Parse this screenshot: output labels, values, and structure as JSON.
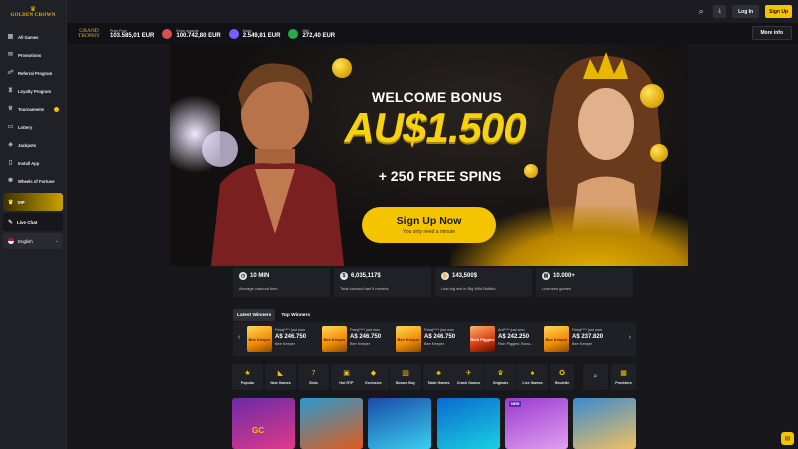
{
  "brand": {
    "name": "GOLDEN CROWN"
  },
  "sidebar": {
    "items": [
      {
        "label": "All Games",
        "icon": "grid-icon"
      },
      {
        "label": "Promotions",
        "icon": "gift-icon"
      },
      {
        "label": "Referral Program",
        "icon": "referral-icon"
      },
      {
        "label": "Loyalty Program",
        "icon": "loyalty-icon"
      },
      {
        "label": "Tournaments",
        "icon": "trophy-icon"
      },
      {
        "label": "Lottery",
        "icon": "ticket-icon"
      },
      {
        "label": "Jackpots",
        "icon": "jackpot-icon"
      },
      {
        "label": "Install App",
        "icon": "phone-icon"
      },
      {
        "label": "Wheels of Fortune",
        "icon": "wheel-icon"
      }
    ],
    "vip": "VIP",
    "live_chat": "Live Chat",
    "language": "English"
  },
  "header": {
    "login": "Log In",
    "signup": "Sign Up"
  },
  "jackpots": {
    "logo_line1": "GRAND",
    "logo_line2": "TROPHY",
    "items": [
      {
        "label": "Prize Pool",
        "value": "103.585,01 EUR"
      },
      {
        "label": "Extra rewards",
        "value": "100.742,80 EUR"
      },
      {
        "label": "Major",
        "value": "2.549,81 EUR"
      },
      {
        "label": "Mini",
        "value": "272,40 EUR"
      }
    ],
    "more_info": "More info",
    "colors": [
      "#e23a3a",
      "#d94f4f",
      "#7a5cff",
      "#2aa84a"
    ]
  },
  "hero": {
    "welcome": "WELCOME BONUS",
    "amount": "AU$1.500",
    "spins": "+ 250 FREE SPINS",
    "cta": "Sign Up Now",
    "cta_sub": "You only need a minute"
  },
  "stats": [
    {
      "value": "10 MIN",
      "label": "Average cashout time."
    },
    {
      "value": "6,035,117$",
      "label": "Total cashout last 5 months"
    },
    {
      "value": "143,500$",
      "label": "Last big win in Big Wild Buffalo"
    },
    {
      "value": "10.000+",
      "label": "Licensed games"
    }
  ],
  "winners": {
    "tabs": [
      "Latest Winners",
      "Top Winners"
    ],
    "items": [
      {
        "who": "Fessj**** just won",
        "amount": "A$ 246.750",
        "game": "Bee Keeper",
        "thumb": "Bee Keeper"
      },
      {
        "who": "Fessj**** just won",
        "amount": "A$ 246.750",
        "game": "Bee Keeper",
        "thumb": "Bee Keeper"
      },
      {
        "who": "Fessj**** just won",
        "amount": "A$ 246.750",
        "game": "Bee Keeper",
        "thumb": "Bee Keeper"
      },
      {
        "who": "Ant**** just won",
        "amount": "A$ 242.250",
        "game": "Rich Piggies: Bonu...",
        "thumb": "Rich Piggies"
      },
      {
        "who": "Fessj**** just won",
        "amount": "A$ 237.820",
        "game": "Bee Keeper",
        "thumb": "Bee Keeper"
      }
    ]
  },
  "categories": [
    {
      "label": "Popular",
      "icon": "star-icon"
    },
    {
      "label": "New Games",
      "icon": "new-icon"
    },
    {
      "label": "Slots",
      "icon": "slot-icon"
    },
    {
      "label": "Hot RTP",
      "icon": "rtp-icon"
    },
    {
      "label": "Exclusive",
      "icon": "diamond-icon"
    },
    {
      "label": "Bonus Buy",
      "icon": "bonus-icon"
    },
    {
      "label": "Table Games",
      "icon": "cards-icon"
    },
    {
      "label": "Crash Games",
      "icon": "crash-icon"
    },
    {
      "label": "Originals",
      "icon": "crown-icon"
    },
    {
      "label": "Live Games",
      "icon": "live-icon"
    },
    {
      "label": "Roulette",
      "icon": "roulette-icon"
    },
    {
      "label": "",
      "icon": "search-icon"
    },
    {
      "label": "Providers",
      "icon": "providers-icon"
    }
  ],
  "tiles": [
    {
      "colors": [
        "#6a2aa8",
        "#e03a8a"
      ],
      "badge": "GC"
    },
    {
      "colors": [
        "#e05a1a",
        "#2a9ad0"
      ],
      "badge": ""
    },
    {
      "colors": [
        "#1a4aa8",
        "#3ad0f0"
      ],
      "badge": ""
    },
    {
      "colors": [
        "#0a6ad0",
        "#1ad0e0"
      ],
      "badge": ""
    },
    {
      "colors": [
        "#9a3ad0",
        "#e0a0f0"
      ],
      "badge": "NEW"
    },
    {
      "colors": [
        "#3a8ad0",
        "#f0c060"
      ],
      "badge": ""
    }
  ]
}
